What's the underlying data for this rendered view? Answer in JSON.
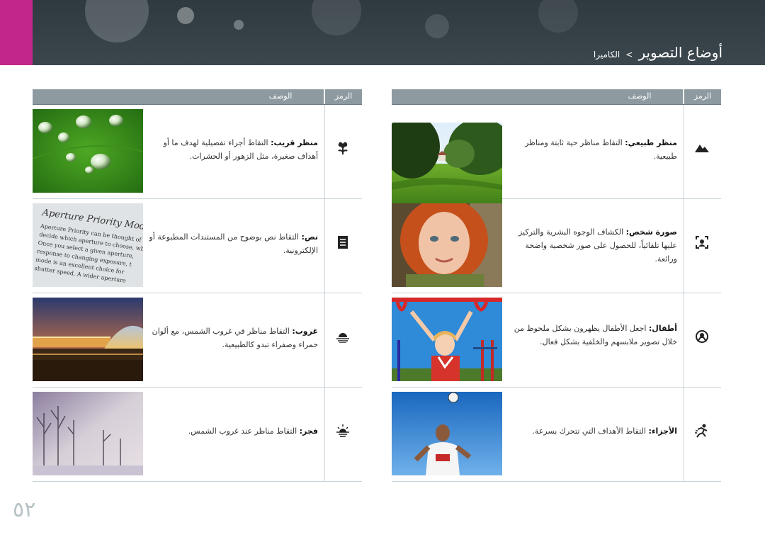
{
  "header": {
    "parent": "الكاميرا",
    "separator": ">",
    "current": "أوضاع التصوير",
    "accent": "#c2268b"
  },
  "table_headers": {
    "icon": "الرمز",
    "description": "الوصف"
  },
  "right_table": [
    {
      "icon": "landscape-icon",
      "title": "منظر طبيعي:",
      "text": "التقاط مناظر حية ثابتة ومناظر طبيعية.",
      "photo": "green-park"
    },
    {
      "icon": "portrait-icon",
      "title": "صورة شخص:",
      "text": "الكشاف الوجوه البشرية والتركيز عليها تلقائياً، للحصول على صور شخصية واضحة ورائعة.",
      "photo": "red-hair-child"
    },
    {
      "icon": "kids-icon",
      "title": "أطفال:",
      "text": "اجعل الأطفال يظهرون بشكل ملحوظ من خلال تصوير ملابسهم والخلفية بشكل فعال.",
      "photo": "child-playground"
    },
    {
      "icon": "sports-icon",
      "title": "الأجزاء:",
      "text": "التقاط الأهداف التي تتحرك بسرعة.",
      "photo": "soccer-player"
    }
  ],
  "left_table": [
    {
      "icon": "macro-icon",
      "title": "منظر قريب:",
      "text": "التقاط أجزاء تفصيلية لهدف ما أو أهداف صغيرة، مثل الزهور أو الحشرات.",
      "photo": "water-drops"
    },
    {
      "icon": "text-icon",
      "title": "نص:",
      "text": "التقاط نص بوضوح من المستندات المطبوعة أو الإلكترونية.",
      "photo": "aperture-text"
    },
    {
      "icon": "sunset-icon",
      "title": "غروب:",
      "text": "التقاط مناظر في غروب الشمس، مع ألوان حمراء وصفراء تبدو كالطبيعية.",
      "photo": "night-building"
    },
    {
      "icon": "dawn-icon",
      "title": "فجر:",
      "text": "التقاط مناظر عند غروب الشمس.",
      "photo": "misty-trees"
    }
  ],
  "page_number": "٥٢"
}
